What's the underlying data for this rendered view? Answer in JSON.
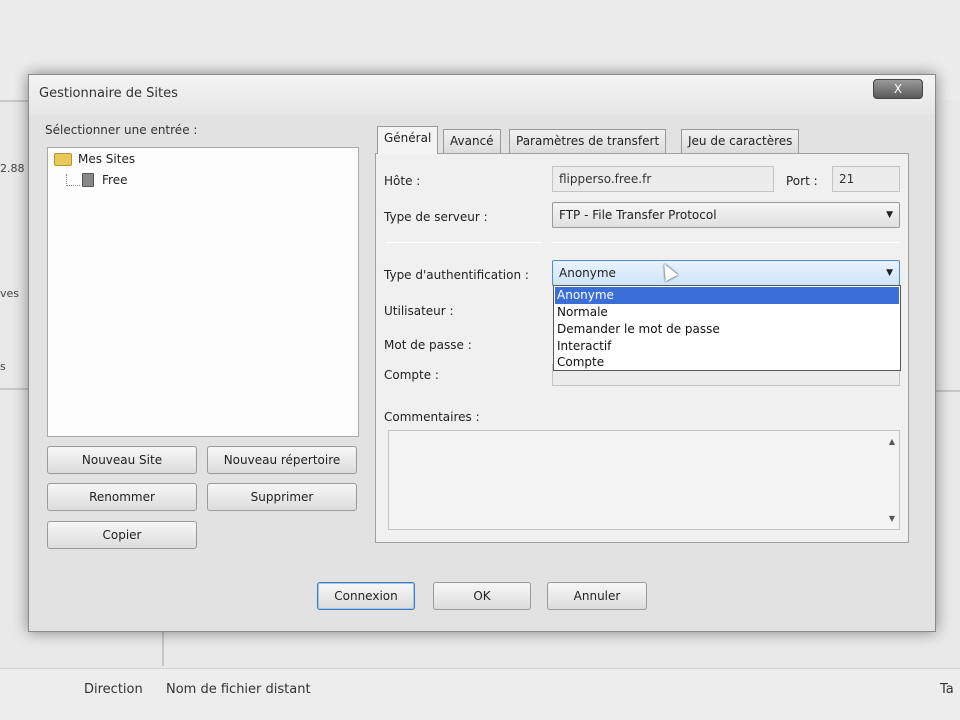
{
  "background": {
    "left_fragments": [
      "2.88",
      "ves",
      "s"
    ],
    "columns": [
      "Direction",
      "Nom de fichier distant",
      "Ta"
    ]
  },
  "dialog": {
    "title": "Gestionnaire de Sites",
    "close_label": "X",
    "tree_label": "Sélectionner une entrée :",
    "tree": {
      "root": "Mes Sites",
      "child": "Free"
    },
    "buttons": {
      "new_site": "Nouveau Site",
      "new_folder": "Nouveau répertoire",
      "rename": "Renommer",
      "delete": "Supprimer",
      "copy": "Copier",
      "connect": "Connexion",
      "ok": "OK",
      "cancel": "Annuler"
    },
    "tabs": [
      "Général",
      "Avancé",
      "Paramètres de transfert",
      "Jeu de caractères"
    ],
    "general": {
      "host_label": "Hôte :",
      "host_value": "flipperso.free.fr",
      "port_label": "Port :",
      "port_value": "21",
      "server_type_label": "Type de serveur :",
      "server_type_value": "FTP - File Transfer Protocol",
      "auth_type_label": "Type d'authentification :",
      "auth_type_value": "Anonyme",
      "user_label": "Utilisateur :",
      "password_label": "Mot de passe :",
      "account_label": "Compte :",
      "comments_label": "Commentaires :"
    },
    "auth_options": [
      "Anonyme",
      "Normale",
      "Demander le mot de passe",
      "Interactif",
      "Compte"
    ],
    "auth_selected_index": 0
  }
}
